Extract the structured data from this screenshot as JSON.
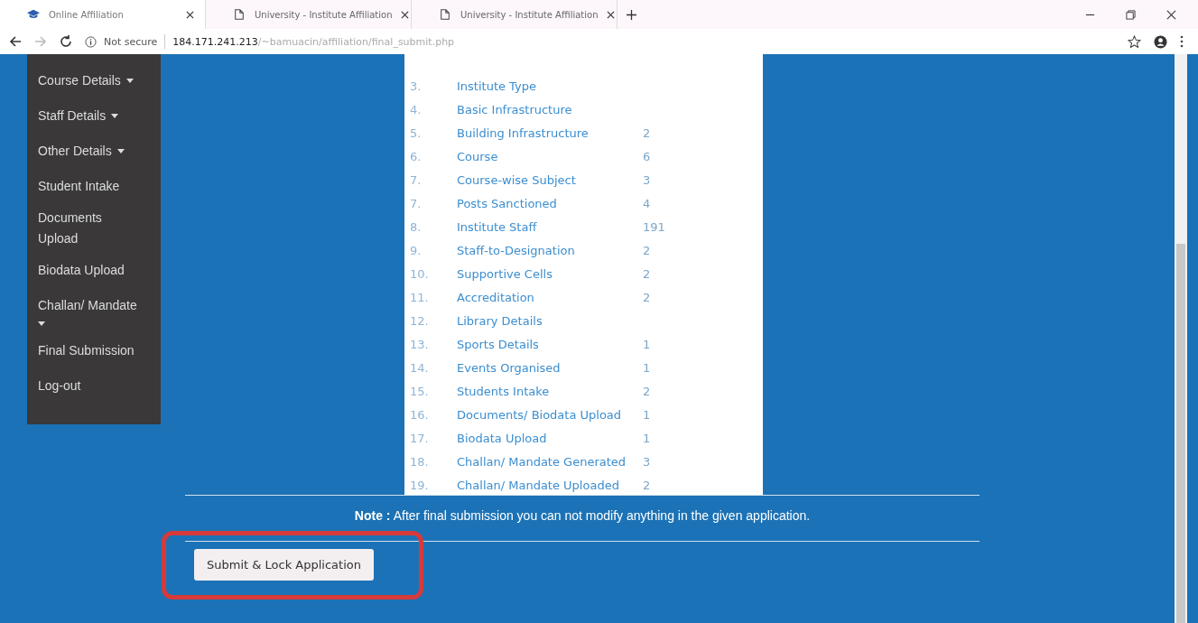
{
  "browser": {
    "tabs": [
      {
        "title": "Online Affiliation",
        "kind": "cap",
        "selected": true
      },
      {
        "title": "University - Institute Affiliation",
        "kind": "page",
        "selected": false
      },
      {
        "title": "University - Institute Affiliation",
        "kind": "page",
        "selected": false
      }
    ],
    "security": "Not secure",
    "url_host": "184.171.241.213",
    "url_path": "/~bamuacin/affiliation/final_submit.php"
  },
  "sidebar": {
    "items": [
      {
        "label": "Course Details",
        "dropdown": true
      },
      {
        "label": "Staff Details",
        "dropdown": true
      },
      {
        "label": "Other Details",
        "dropdown": true
      },
      {
        "label": "Student Intake",
        "dropdown": false
      },
      {
        "label": "Documents Upload",
        "dropdown": false
      },
      {
        "label": "Biodata Upload",
        "dropdown": false
      },
      {
        "label": "Challan/ Mandate",
        "dropdown": true
      },
      {
        "label": "Final Submission",
        "dropdown": false
      },
      {
        "label": "Log-out",
        "dropdown": false
      }
    ]
  },
  "summary": {
    "rows": [
      {
        "no": "3.",
        "name": "Institute Type"
      },
      {
        "no": "4.",
        "name": "Basic Infrastructure"
      },
      {
        "no": "5.",
        "name": "Building Infrastructure",
        "count": "2"
      },
      {
        "no": "6.",
        "name": "Course",
        "count": "6"
      },
      {
        "no": "7.",
        "name": "Course-wise Subject",
        "count": "3"
      },
      {
        "no": "7.",
        "name": "Posts Sanctioned",
        "count": "4"
      },
      {
        "no": "8.",
        "name": "Institute Staff",
        "count": "191"
      },
      {
        "no": "9.",
        "name": "Staff-to-Designation",
        "count": "2"
      },
      {
        "no": "10.",
        "name": "Supportive Cells",
        "count": "2"
      },
      {
        "no": "11.",
        "name": "Accreditation",
        "count": "2"
      },
      {
        "no": "12.",
        "name": "Library Details"
      },
      {
        "no": "13.",
        "name": "Sports Details",
        "count": "1"
      },
      {
        "no": "14.",
        "name": "Events Organised",
        "count": "1"
      },
      {
        "no": "15.",
        "name": "Students Intake",
        "count": "2"
      },
      {
        "no": "16.",
        "name": "Documents/ Biodata Upload",
        "count": "1"
      },
      {
        "no": "17.",
        "name": "Biodata Upload",
        "count": "1"
      },
      {
        "no": "18.",
        "name": "Challan/ Mandate Generated",
        "count": "3"
      },
      {
        "no": "19.",
        "name": "Challan/ Mandate Uploaded",
        "count": "2"
      }
    ]
  },
  "note": "**Note :** After final submission you can not modify anything in the given application.",
  "submit_button": "Submit & Lock Application"
}
